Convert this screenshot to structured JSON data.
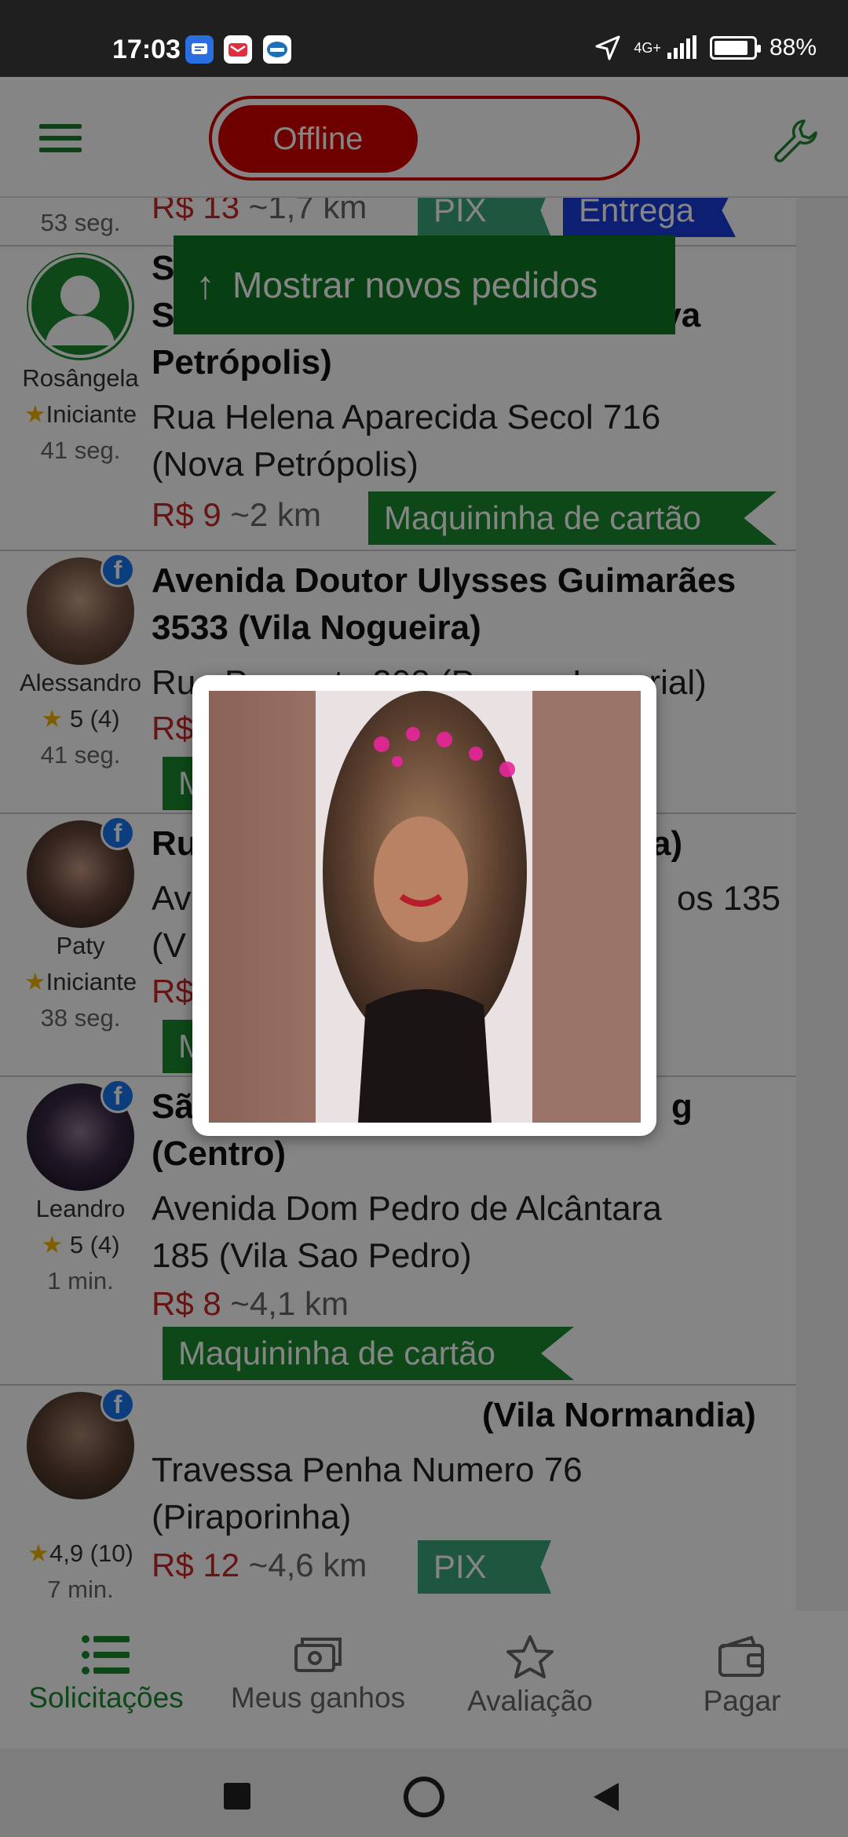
{
  "status_bar": {
    "time": "17:03",
    "network": "4G+",
    "battery_percent": "88%",
    "battery_level": 0.88
  },
  "app_bar": {
    "status_toggle_label": "Offline"
  },
  "banner": {
    "label": "Mostrar novos pedidos"
  },
  "orders": [
    {
      "time": "53 seg.",
      "price": "R$ 13",
      "distance": "~1,7 km",
      "tags": [
        "PIX",
        "Entrega"
      ]
    },
    {
      "user_name": "Rosângela",
      "rating": "Iniciante",
      "time": "41 seg.",
      "title_line1": "S",
      "title_line2": "S",
      "title_line2_end": "(Nova",
      "title_line3": "Petrópolis)",
      "address_line1": "Rua Helena Aparecida Secol 716",
      "address_line2": "(Nova Petrópolis)",
      "price": "R$ 9",
      "distance": "~2 km",
      "tags": [
        "Maquininha de cartão"
      ]
    },
    {
      "user_name": "Alessandro",
      "rating": "5 (4)",
      "time": "41 seg.",
      "title_line1": "Avenida Doutor Ulysses Guimarães",
      "title_line2": "3533 (Vila Nogueira)",
      "address_line1": "Rua Parecatu 208 (Parque Imperial)",
      "price": "R$",
      "tags": [
        "M"
      ]
    },
    {
      "user_name": "Paty",
      "rating": "Iniciante",
      "time": "38 seg.",
      "title_line1": "Ru",
      "title_line1_end": "a)",
      "address_line1": "Av",
      "address_line1_end": "os 135",
      "address_line2": "(V",
      "price": "R$",
      "tags": [
        "M"
      ]
    },
    {
      "user_name": "Leandro",
      "rating": "5 (4)",
      "time": "1 min.",
      "title_line1": "Sã",
      "title_line1_end": "g",
      "title_line2": "(Centro)",
      "address_line1": "Avenida Dom Pedro de Alcântara",
      "address_line2": "185 (Vila Sao Pedro)",
      "price": "R$ 8",
      "distance": "~4,1 km",
      "tags": [
        "Maquininha de cartão"
      ]
    },
    {
      "rating": "4,9 (10)",
      "time": "7 min.",
      "title_line1": "(Vila Normandia)",
      "address_line1": "Travessa Penha Numero 76",
      "address_line2": "(Piraporinha)",
      "price": "R$ 12",
      "distance": "~4,6 km",
      "tags": [
        "PIX"
      ]
    }
  ],
  "bottom_nav": [
    {
      "label": "Solicitações",
      "icon": "list-icon",
      "active": true
    },
    {
      "label": "Meus ganhos",
      "icon": "money-icon",
      "active": false
    },
    {
      "label": "Avaliação",
      "icon": "star-icon",
      "active": false
    },
    {
      "label": "Pagar",
      "icon": "wallet-icon",
      "active": false
    }
  ],
  "colors": {
    "brand_green": "#1b8a2f",
    "offline_red": "#d40000",
    "price_red": "#c62828",
    "tag_blue": "#1a3cdc",
    "tag_teal": "#3aa57c"
  }
}
